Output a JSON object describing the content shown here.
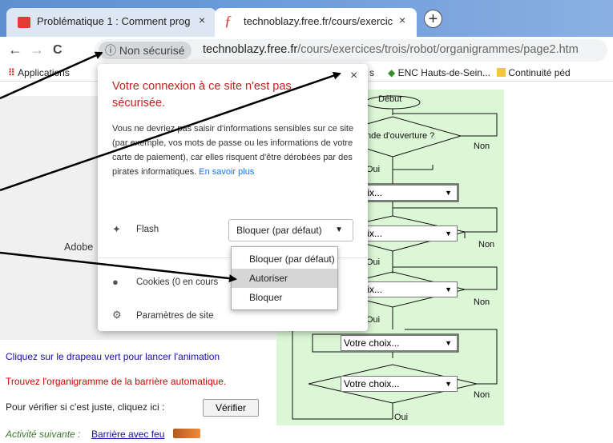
{
  "tabs": [
    {
      "title": "Problématique 1 : Comment prog",
      "favicon": "red-logo-icon",
      "close": "×"
    },
    {
      "title": "technoblazy.free.fr/cours/exercic",
      "favicon": "f-icon",
      "close": "×"
    }
  ],
  "new_tab": "+",
  "toolbar": {
    "back": "←",
    "forward": "→",
    "reload": "C",
    "security_chip": "Non sécurisé",
    "security_icon": "ⓘ",
    "url_host": "technoblazy.free.fr",
    "url_path": "/cours/exercices/trois/robot/organigrammes/page2.htm"
  },
  "bookmarks": [
    {
      "label": "Applications",
      "icon": "apps-grid-icon"
    },
    {
      "label": "s",
      "icon": ""
    },
    {
      "label": "ENC Hauts-de-Sein...",
      "icon": "green-diamond-icon"
    },
    {
      "label": "Continuité péd",
      "icon": "folder-icon"
    }
  ],
  "popup": {
    "title": "Votre connexion à ce site n'est pas sécurisée.",
    "body": "Vous ne devriez pas saisir d'informations sensibles sur ce site (par exemple, vos mots de passe ou les informations de votre carte de paiement), car elles risquent d'être dérobées par des pirates informatiques.",
    "learn_more": "En savoir plus",
    "close": "×",
    "flash_label": "Flash",
    "flash_value": "Bloquer (par défaut)",
    "cookies_label": "Cookies (0 en cours",
    "settings_label": "Paramètres de site",
    "dropdown_options": [
      "Bloquer (par défaut)",
      "Autoriser",
      "Bloquer"
    ],
    "dropdown_selected_index": 1
  },
  "page": {
    "adobe_text": "Adobe",
    "link_green_flag": "Cliquez sur le drapeau vert pour lancer l'animation",
    "instruction": "Trouvez l'organigramme de la barrière automatique.",
    "verify_prompt": "Pour vérifier si c'est juste, cliquez ici :",
    "verify_button": "Vérifier",
    "next_activity_label": "Activité suivante :",
    "next_activity_link": "Barrière avec feu"
  },
  "flowchart": {
    "start": "Début",
    "question_1": "nde d'ouverture ?",
    "choice_placeholder": "Votre choix...",
    "choice_partial": "e choix...",
    "yes": "Oui",
    "no": "Non"
  },
  "colors": {
    "link_blue": "#1a0dab",
    "instruction_red": "#d40000",
    "warning_red": "#c5221f",
    "flowchart_bg": "#dcf7d6"
  }
}
